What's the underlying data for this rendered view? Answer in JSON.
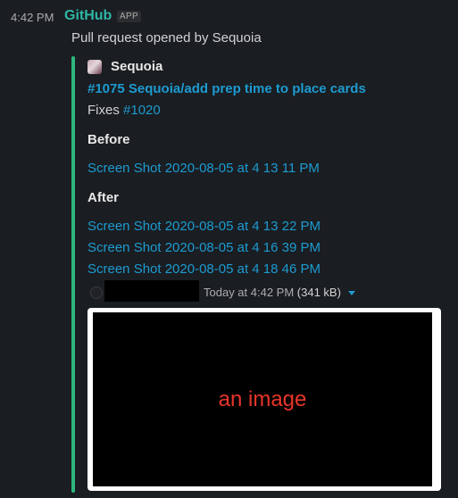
{
  "message": {
    "time": "4:42 PM",
    "sender": "GitHub",
    "badge": "APP",
    "summary": "Pull request opened by Sequoia"
  },
  "attachment": {
    "bar_color": "#2eb67d",
    "author": "Sequoia",
    "pr_title": "#1075 Sequoia/add prep time to place cards",
    "fixes_label": "Fixes",
    "fixes_issue": "#1020",
    "before_heading": "Before",
    "before_links": [
      "Screen Shot 2020-08-05 at 4 13 11 PM"
    ],
    "after_heading": "After",
    "after_links": [
      "Screen Shot 2020-08-05 at 4 13 22 PM",
      "Screen Shot 2020-08-05 at 4 16 39 PM",
      "Screen Shot 2020-08-05 at 4 18 46 PM"
    ]
  },
  "file": {
    "timestamp": "Today at 4:42 PM",
    "size": "(341 kB)",
    "image_placeholder": "an image"
  },
  "colors": {
    "background": "#1a1d21",
    "link": "#1d9bd1",
    "sender": "#2eb6a6",
    "placeholder_text": "#e8352a"
  }
}
